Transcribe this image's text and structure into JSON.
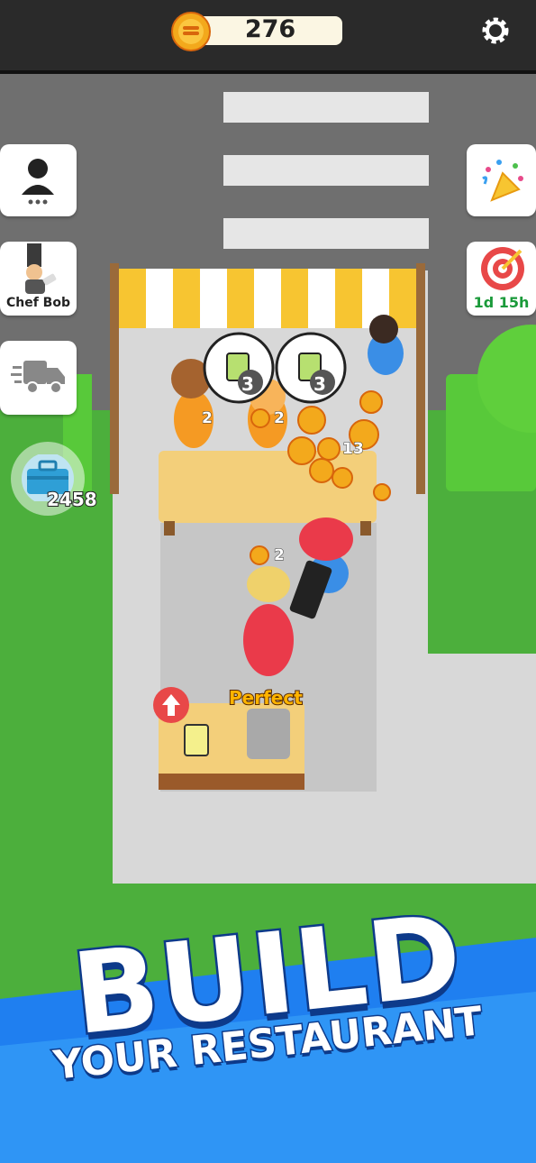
{
  "hud": {
    "coins": "276",
    "settings_icon": "gear-icon"
  },
  "left_menu": {
    "profile_icon": "person-icon",
    "chef_label": "Chef Bob",
    "delivery_icon": "truck-icon",
    "toolbox_count": "2458"
  },
  "right_menu": {
    "party_icon": "party-popper-icon",
    "target_timer": "1d 15h"
  },
  "scene": {
    "order_bubbles": [
      "3",
      "3"
    ],
    "customer_coin_counts": [
      "2",
      "2"
    ],
    "coin_pile_count": "13",
    "player_coin_count": "2",
    "rating_text": "Perfect",
    "upgrade_icon": "arrow-up-icon"
  },
  "banner": {
    "line1": "BUILD",
    "line2": "YOUR RESTAURANT"
  },
  "colors": {
    "grass": "#4caf3c",
    "road": "#d9d9d9",
    "awning_yellow": "#f7c531",
    "banner_blue": "#1f7ff0"
  }
}
